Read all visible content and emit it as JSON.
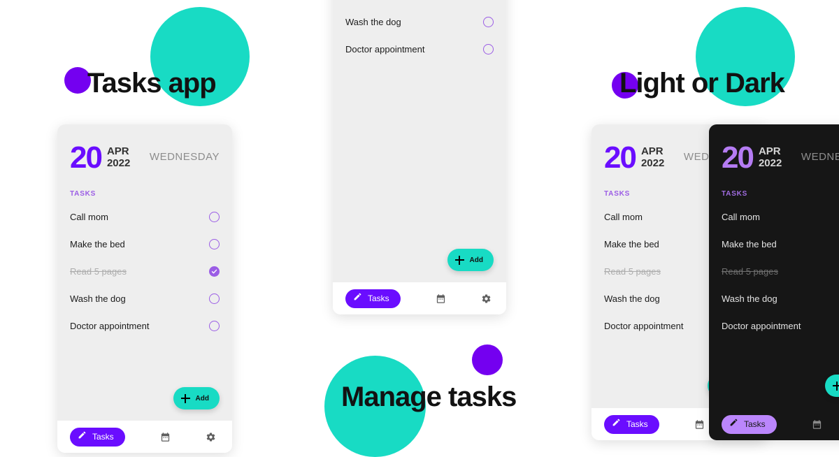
{
  "page": {
    "background": "#ffffff",
    "accent_teal": "#18dbc4",
    "accent_purple": "#7400f0",
    "accent_purple_light": "#9b5de5",
    "accent_purple_dark_theme": "#bb86fc"
  },
  "headings": {
    "tasks_app": "Tasks app",
    "manage_tasks": "Manage tasks",
    "light_or_dark": "Light or Dark"
  },
  "date": {
    "day": "20",
    "month": "APR",
    "year": "2022",
    "weekday": "WEDNESDAY"
  },
  "section": {
    "tasks_label": "TASKS"
  },
  "tasks": [
    {
      "label": "Call mom",
      "done": false
    },
    {
      "label": "Make the bed",
      "done": false
    },
    {
      "label": "Read 5 pages",
      "done": true
    },
    {
      "label": "Wash the dog",
      "done": false
    },
    {
      "label": "Doctor appointment",
      "done": false
    }
  ],
  "fab": {
    "label": "Add",
    "icon": "plus-icon",
    "color": "#18dbc4"
  },
  "bottom_nav": {
    "tasks_label": "Tasks",
    "tasks_icon": "pencil-icon",
    "calendar_icon": "calendar-icon",
    "settings_icon": "gear-icon"
  },
  "screens": [
    {
      "name": "phone-light-primary",
      "theme": "light"
    },
    {
      "name": "phone-light-overview",
      "theme": "light"
    },
    {
      "name": "phone-light-compare",
      "theme": "light"
    },
    {
      "name": "phone-dark-compare",
      "theme": "dark"
    }
  ]
}
